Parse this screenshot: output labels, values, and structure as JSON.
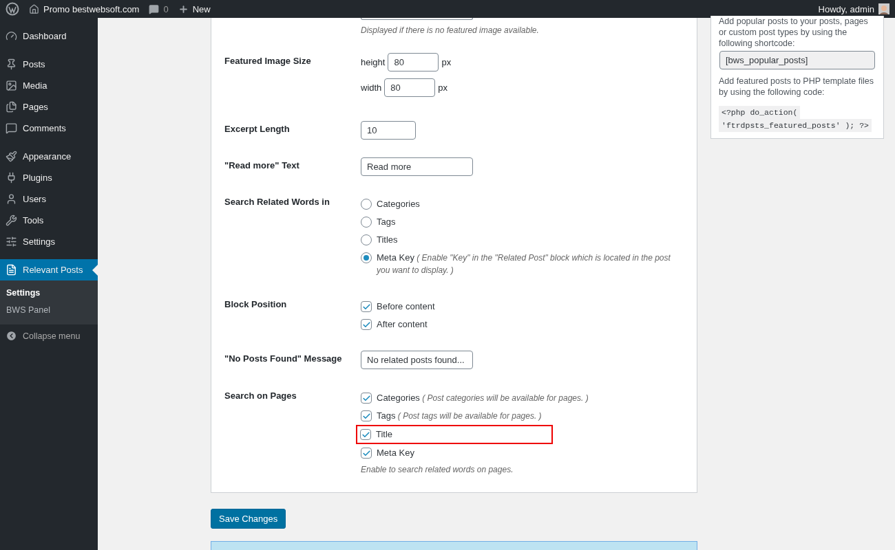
{
  "admin_bar": {
    "site": "Promo bestwebsoft.com",
    "comments": "0",
    "new": "New",
    "greeting": "Howdy, admin"
  },
  "menu": [
    [
      {
        "label": "Dashboard",
        "selected": false
      }
    ],
    [
      {
        "label": "Posts",
        "selected": false
      },
      {
        "label": "Media",
        "selected": false
      },
      {
        "label": "Pages",
        "selected": false
      },
      {
        "label": "Comments",
        "selected": false
      }
    ],
    [
      {
        "label": "Appearance",
        "selected": false
      },
      {
        "label": "Plugins",
        "selected": false
      },
      {
        "label": "Users",
        "selected": false
      },
      {
        "label": "Tools",
        "selected": false
      },
      {
        "label": "Settings",
        "selected": false
      }
    ],
    [
      {
        "label": "Relevant Posts",
        "selected": true,
        "children": [
          {
            "label": "Settings",
            "selected": true
          },
          {
            "label": "BWS Panel",
            "selected": false
          }
        ]
      }
    ]
  ],
  "collapse": "Collapse menu",
  "settings": {
    "top_hint": "Displayed if there is no featured image available.",
    "rows": [
      {
        "label": "Featured Image Size",
        "kind": "size",
        "fields": [
          {
            "label": "height",
            "value": "80",
            "unit": "px"
          },
          {
            "label": "width",
            "value": "80",
            "unit": "px"
          }
        ]
      },
      {
        "label": "Excerpt Length",
        "kind": "number",
        "value": "10"
      },
      {
        "label": "\"Read more\" Text",
        "kind": "text",
        "value": "Read more"
      },
      {
        "label": "Search Related Words in",
        "kind": "radio",
        "options": [
          {
            "label": "Categories",
            "selected": false
          },
          {
            "label": "Tags",
            "selected": false
          },
          {
            "label": "Titles",
            "selected": false
          },
          {
            "label": "Meta Key",
            "note": "( Enable \"Key\" in the \"Related Post\" block which is located in the post you want to display. )",
            "selected": true
          }
        ]
      },
      {
        "label": "Block Position",
        "kind": "checkbox",
        "options": [
          {
            "label": "Before content",
            "checked": true
          },
          {
            "label": "After content",
            "checked": true
          }
        ]
      },
      {
        "label": "\"No Posts Found\" Message",
        "kind": "text",
        "value": "No related posts found..."
      },
      {
        "label": "Search on Pages",
        "kind": "checkbox",
        "options": [
          {
            "label": "Categories",
            "note": "( Post categories will be available for pages. )",
            "checked": true
          },
          {
            "label": "Tags",
            "note": "( Post tags will be available for pages. )",
            "checked": true
          },
          {
            "label": "Title",
            "checked": true,
            "highlighted": true
          },
          {
            "label": "Meta Key",
            "checked": true
          }
        ],
        "hint": "Enable to search related words on pages."
      }
    ]
  },
  "save_button": "Save Changes",
  "widget": {
    "text_1": "Add popular posts to your posts, pages or custom post types by using the following shortcode:",
    "shortcode": "[bws_popular_posts]",
    "text_2": "Add featured posts to PHP template files by using the following code:",
    "code_1": "<?php do_action(",
    "code_2": "'ftrdpsts_featured_posts' ); ?>"
  }
}
